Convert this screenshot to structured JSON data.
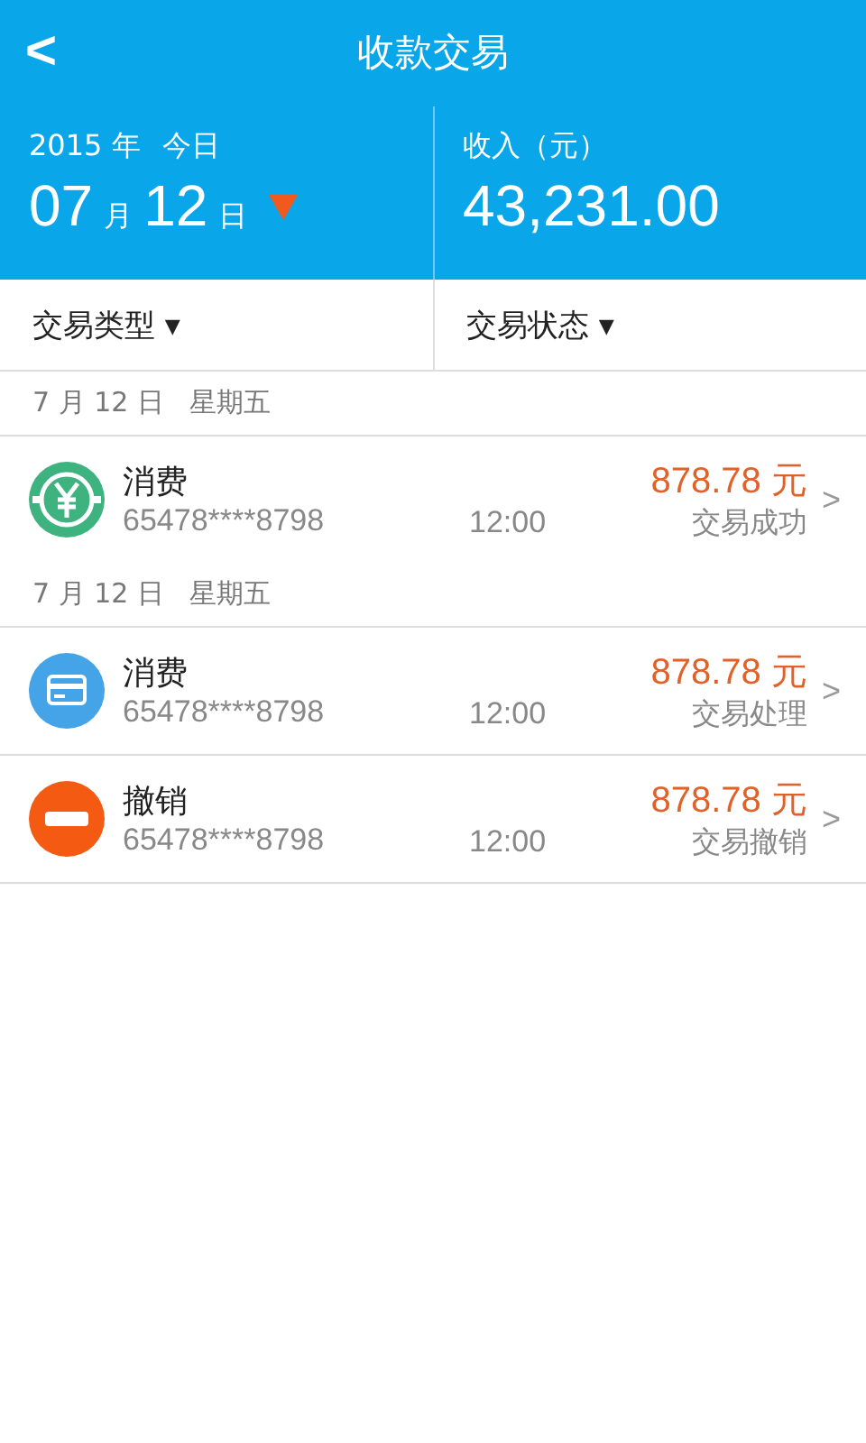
{
  "header": {
    "back": "<",
    "title": "收款交易"
  },
  "summary": {
    "year": "2015 年",
    "today": "今日",
    "month": "07",
    "month_unit": "月",
    "day": "12",
    "day_unit": "日",
    "income_label": "收入（元）",
    "income": "43,231.00"
  },
  "filters": [
    {
      "label": "交易类型",
      "caret": "▾"
    },
    {
      "label": "交易状态",
      "caret": "▾"
    }
  ],
  "groups": [
    {
      "date": "7 月 12 日",
      "weekday": "星期五",
      "transactions": [
        {
          "kind": "yuan",
          "type": "消费",
          "card": "65478****8798",
          "time": "12:00",
          "amount": "878.78 元",
          "status": "交易成功",
          "chevron": ">"
        }
      ]
    },
    {
      "date": "7 月 12 日",
      "weekday": "星期五",
      "transactions": [
        {
          "kind": "card",
          "type": "消费",
          "card": "65478****8798",
          "time": "12:00",
          "amount": "878.78 元",
          "status": "交易处理",
          "chevron": ">"
        },
        {
          "kind": "cancel",
          "type": "撤销",
          "card": "65478****8798",
          "time": "12:00",
          "amount": "878.78 元",
          "status": "交易撤销",
          "chevron": ">"
        }
      ]
    }
  ]
}
